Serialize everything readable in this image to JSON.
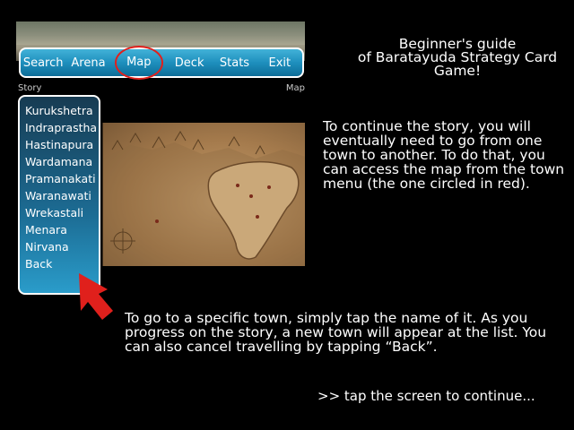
{
  "nav": {
    "items": [
      "Search",
      "Arena",
      "Map",
      "Deck",
      "Stats",
      "Exit"
    ],
    "active_index": 2
  },
  "labels": {
    "story": "Story",
    "map": "Map"
  },
  "story_menu": {
    "towns": [
      "Kurukshetra",
      "Indraprastha",
      "Hastinapura",
      "Wardamana",
      "Pramanakati",
      "Waranawati",
      "Wrekastali",
      "Menara",
      "Nirvana",
      "Back"
    ]
  },
  "guide": {
    "title_line1": "Beginner's guide",
    "title_line2": "of Baratayuda Strategy Card",
    "title_line3": "Game!",
    "paragraph1": "To continue the story, you will eventually need to go from one town to another. To do that, you can access the map from the town menu (the one circled in red).",
    "paragraph2": "To go to a specific town, simply tap the name of it. As you progress on the story, a new town will appear at the list. You can also cancel travelling by tapping “Back”.",
    "continue": ">> tap the screen to continue..."
  },
  "colors": {
    "highlight_circle": "#e0201c",
    "arrow": "#e0201c",
    "menu_blue": "#1e8fbd"
  }
}
